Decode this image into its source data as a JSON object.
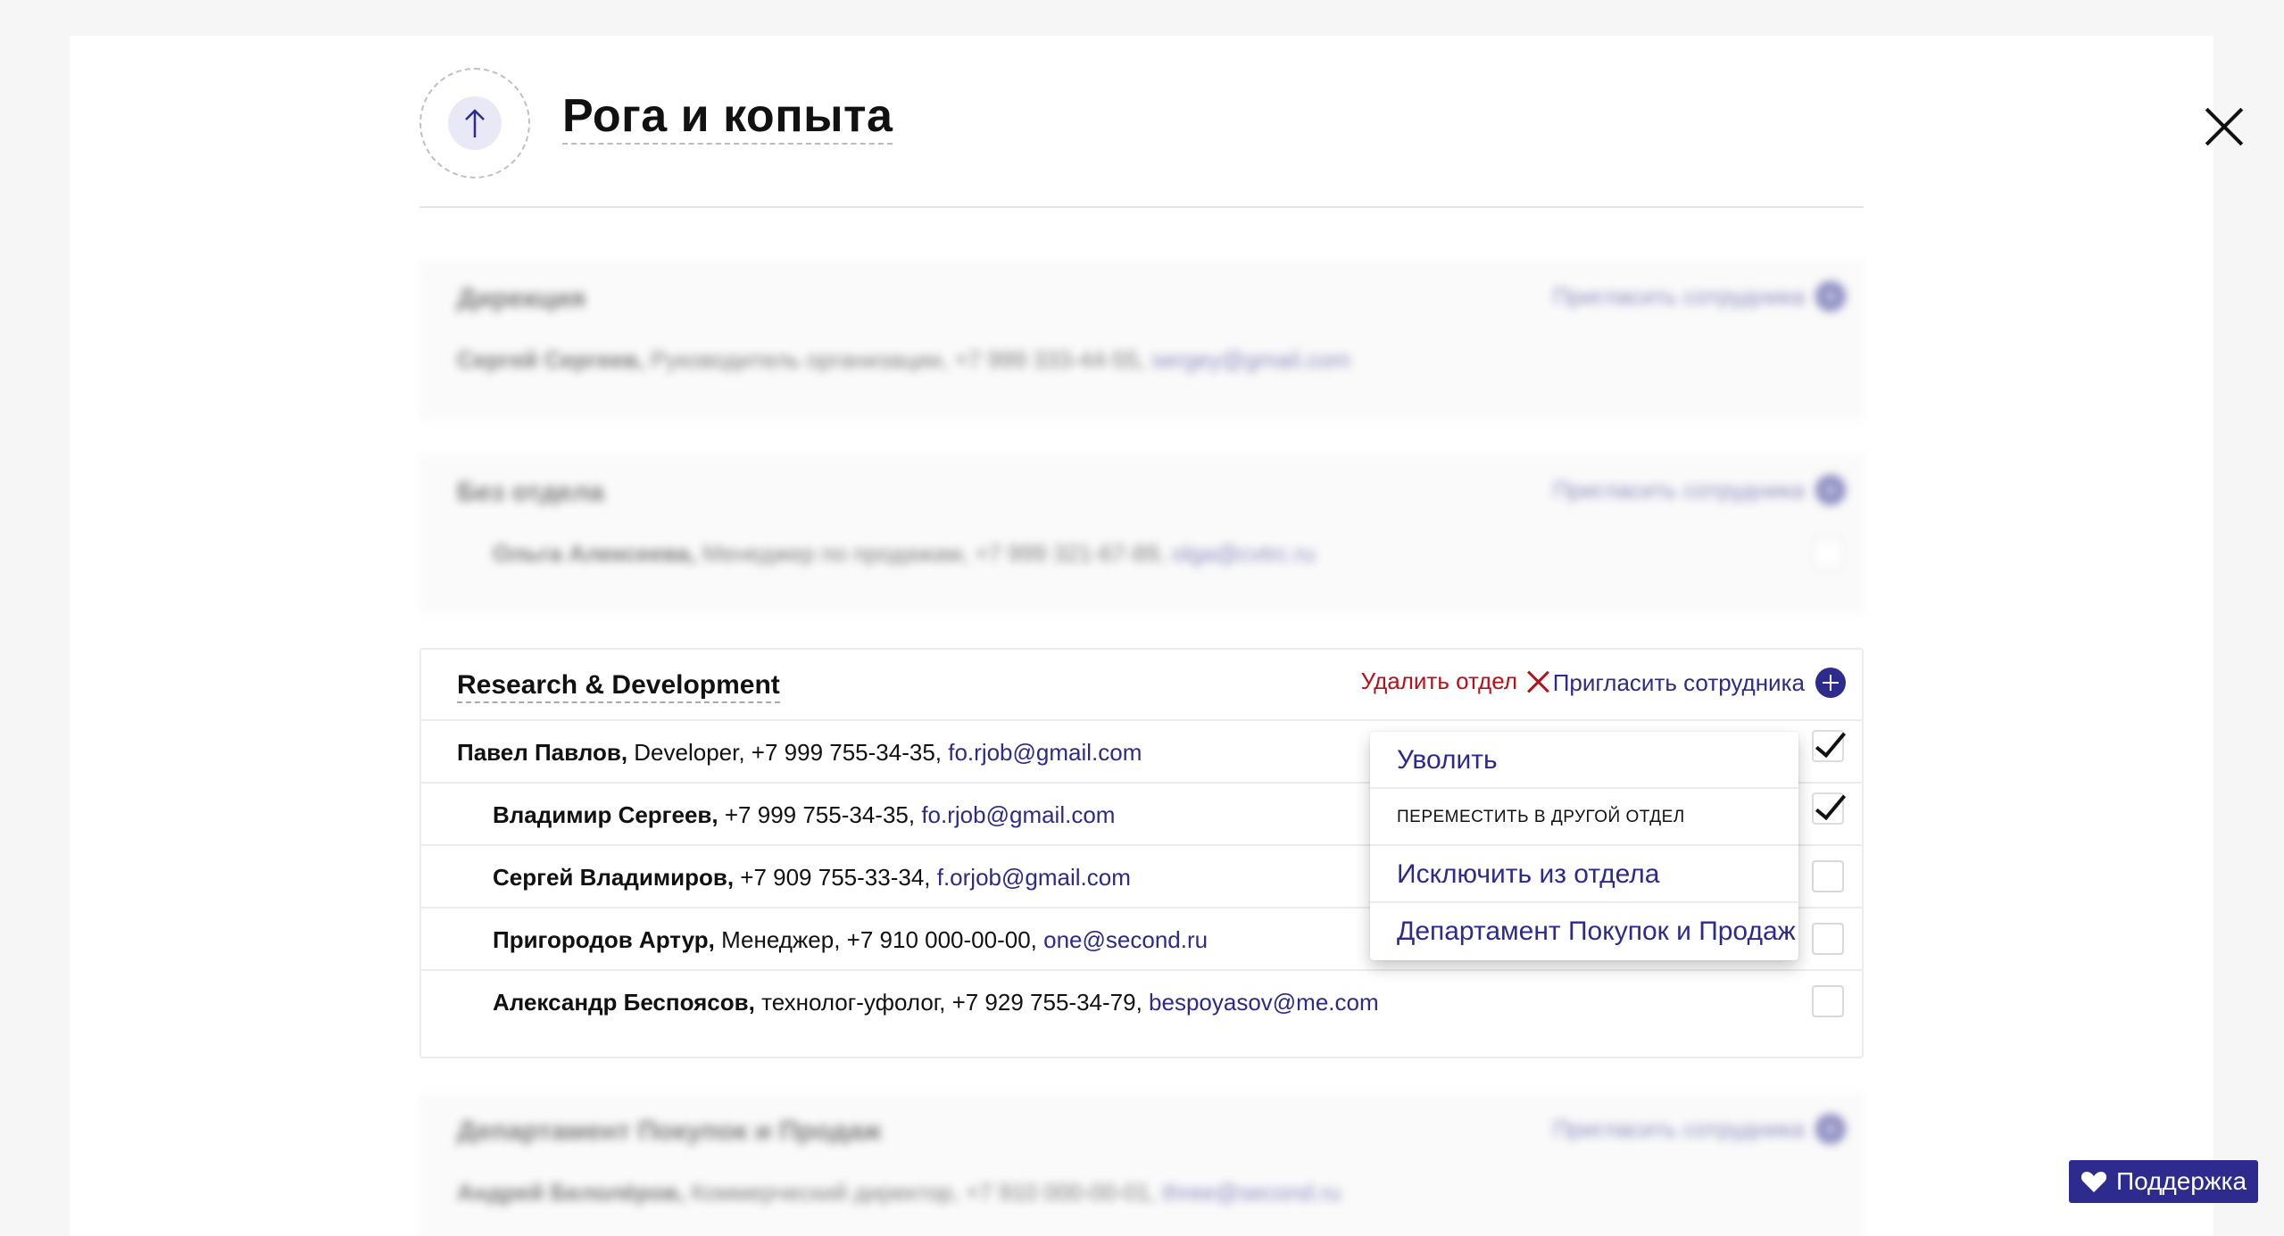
{
  "org": {
    "title": "Рога и копыта"
  },
  "blurred_depts": [
    {
      "name": "Дирекция",
      "invite": "Пригласить сотрудника",
      "employee": {
        "name": "Сергей Сергеев,",
        "details": " Руководитель организации, +7 999 333-44-55, ",
        "email": "sergey@gmail.com"
      }
    },
    {
      "name": "Без отдела",
      "invite": "Пригласить сотрудника",
      "employee": {
        "name": "Ольга Алексеева,",
        "details": " Менеджер по продажам, +7 999 321-67-89, ",
        "email": "olga@cvtrc.ru"
      }
    },
    {
      "name": "Департамент Покупок и Продаж",
      "invite": "Пригласить сотрудника",
      "employee": {
        "name": "Андрей Белолёров,",
        "details": " Коммерческий директор, +7 910 000-00-01, ",
        "email": "three@second.ru"
      }
    }
  ],
  "active_dept": {
    "name": "Research & Development",
    "delete_label": "Удалить отдел",
    "invite_label": "Пригласить сотрудника",
    "employees": [
      {
        "name": "Павел Павлов,",
        "details": " Developer, +7 999 755-34-35, ",
        "email": "fo.rjob@gmail.com",
        "checked": true
      },
      {
        "name": "Владимир Сергеев,",
        "details": " +7 999 755-34-35, ",
        "email": "fo.rjob@gmail.com",
        "checked": true
      },
      {
        "name": "Сергей Владимиров,",
        "details": " +7 909 755-33-34, ",
        "email": "f.orjob@gmail.com",
        "checked": false
      },
      {
        "name": "Пригородов Артур,",
        "details": " Менеджер, +7 910 000-00-00, ",
        "email": "one@second.ru",
        "checked": false
      },
      {
        "name": "Александр Беспоясов,",
        "details": " технолог-уфолог, +7 929 755-34-79, ",
        "email": "bespoyasov@me.com",
        "checked": false
      }
    ]
  },
  "context_menu": {
    "fire": "Уволить",
    "move_caption": "переместить в другой отдел",
    "exclude": "Исключить из отдела",
    "target_dept": "Департамент Покупок и Продаж"
  },
  "support": {
    "label": "Поддержка"
  },
  "colors": {
    "accent": "#2e2b8f",
    "link": "#2c2a8a",
    "danger": "#b3121a"
  },
  "icons": [
    "close-icon",
    "arrow-up-icon",
    "plus-circle-icon",
    "delete-x-icon",
    "heart-icon",
    "checkmark-icon"
  ]
}
